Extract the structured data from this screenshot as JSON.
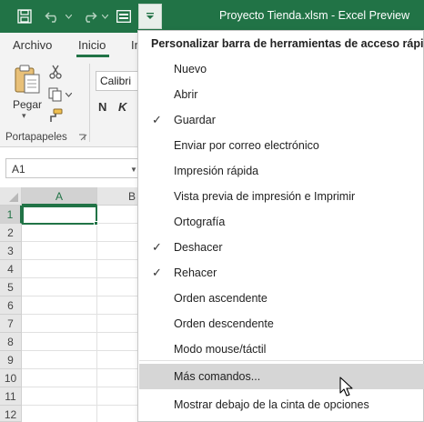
{
  "window": {
    "title": "Proyecto Tienda.xlsm  -  Excel Preview",
    "accent_color": "#217346"
  },
  "quick_access": {
    "save_icon": "save-icon",
    "undo_icon": "undo-icon",
    "redo_icon": "redo-icon",
    "form_icon": "form-icon",
    "customize_icon": "customize-qat-icon"
  },
  "ribbon": {
    "tabs": [
      {
        "label": "Archivo"
      },
      {
        "label": "Inicio"
      },
      {
        "label": "In"
      }
    ],
    "active_tab": "Inicio",
    "clipboard": {
      "paste_label": "Pegar",
      "group_label": "Portapapeles"
    },
    "font": {
      "name": "Calibri",
      "bold": "N",
      "italic": "K"
    }
  },
  "formula_bar": {
    "name_box": "A1"
  },
  "sheet": {
    "columns": [
      "A",
      "B"
    ],
    "selected_column": "A",
    "rows": [
      "1",
      "2",
      "3",
      "4",
      "5",
      "6",
      "7",
      "8",
      "9",
      "10",
      "11",
      "12"
    ],
    "selected_row": "1"
  },
  "qat_menu": {
    "header": "Personalizar barra de herramientas de acceso rápido",
    "items": [
      {
        "label": "Nuevo",
        "checked": false
      },
      {
        "label": "Abrir",
        "checked": false
      },
      {
        "label": "Guardar",
        "checked": true
      },
      {
        "label": "Enviar por correo electrónico",
        "checked": false
      },
      {
        "label": "Impresión rápida",
        "checked": false
      },
      {
        "label": "Vista previa de impresión e Imprimir",
        "checked": false
      },
      {
        "label": "Ortografía",
        "checked": false
      },
      {
        "label": "Deshacer",
        "checked": true
      },
      {
        "label": "Rehacer",
        "checked": true
      },
      {
        "label": "Orden ascendente",
        "checked": false
      },
      {
        "label": "Orden descendente",
        "checked": false
      },
      {
        "label": "Modo mouse/táctil",
        "checked": false
      },
      {
        "label": "Más comandos...",
        "checked": false,
        "hovered": true
      },
      {
        "label": "Mostrar debajo de la cinta de opciones",
        "checked": false
      }
    ],
    "check_glyph": "✓"
  }
}
